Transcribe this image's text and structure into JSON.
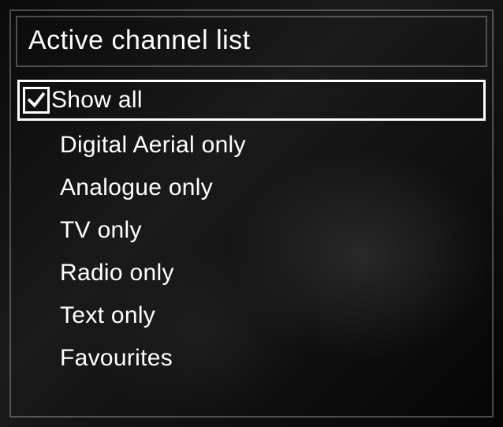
{
  "title": "Active channel list",
  "items": [
    {
      "label": "Show all",
      "checked": true,
      "selected": true
    },
    {
      "label": "Digital Aerial only",
      "checked": false,
      "selected": false
    },
    {
      "label": "Analogue only",
      "checked": false,
      "selected": false
    },
    {
      "label": "TV only",
      "checked": false,
      "selected": false
    },
    {
      "label": "Radio only",
      "checked": false,
      "selected": false
    },
    {
      "label": "Text only",
      "checked": false,
      "selected": false
    },
    {
      "label": "Favourites",
      "checked": false,
      "selected": false
    }
  ]
}
